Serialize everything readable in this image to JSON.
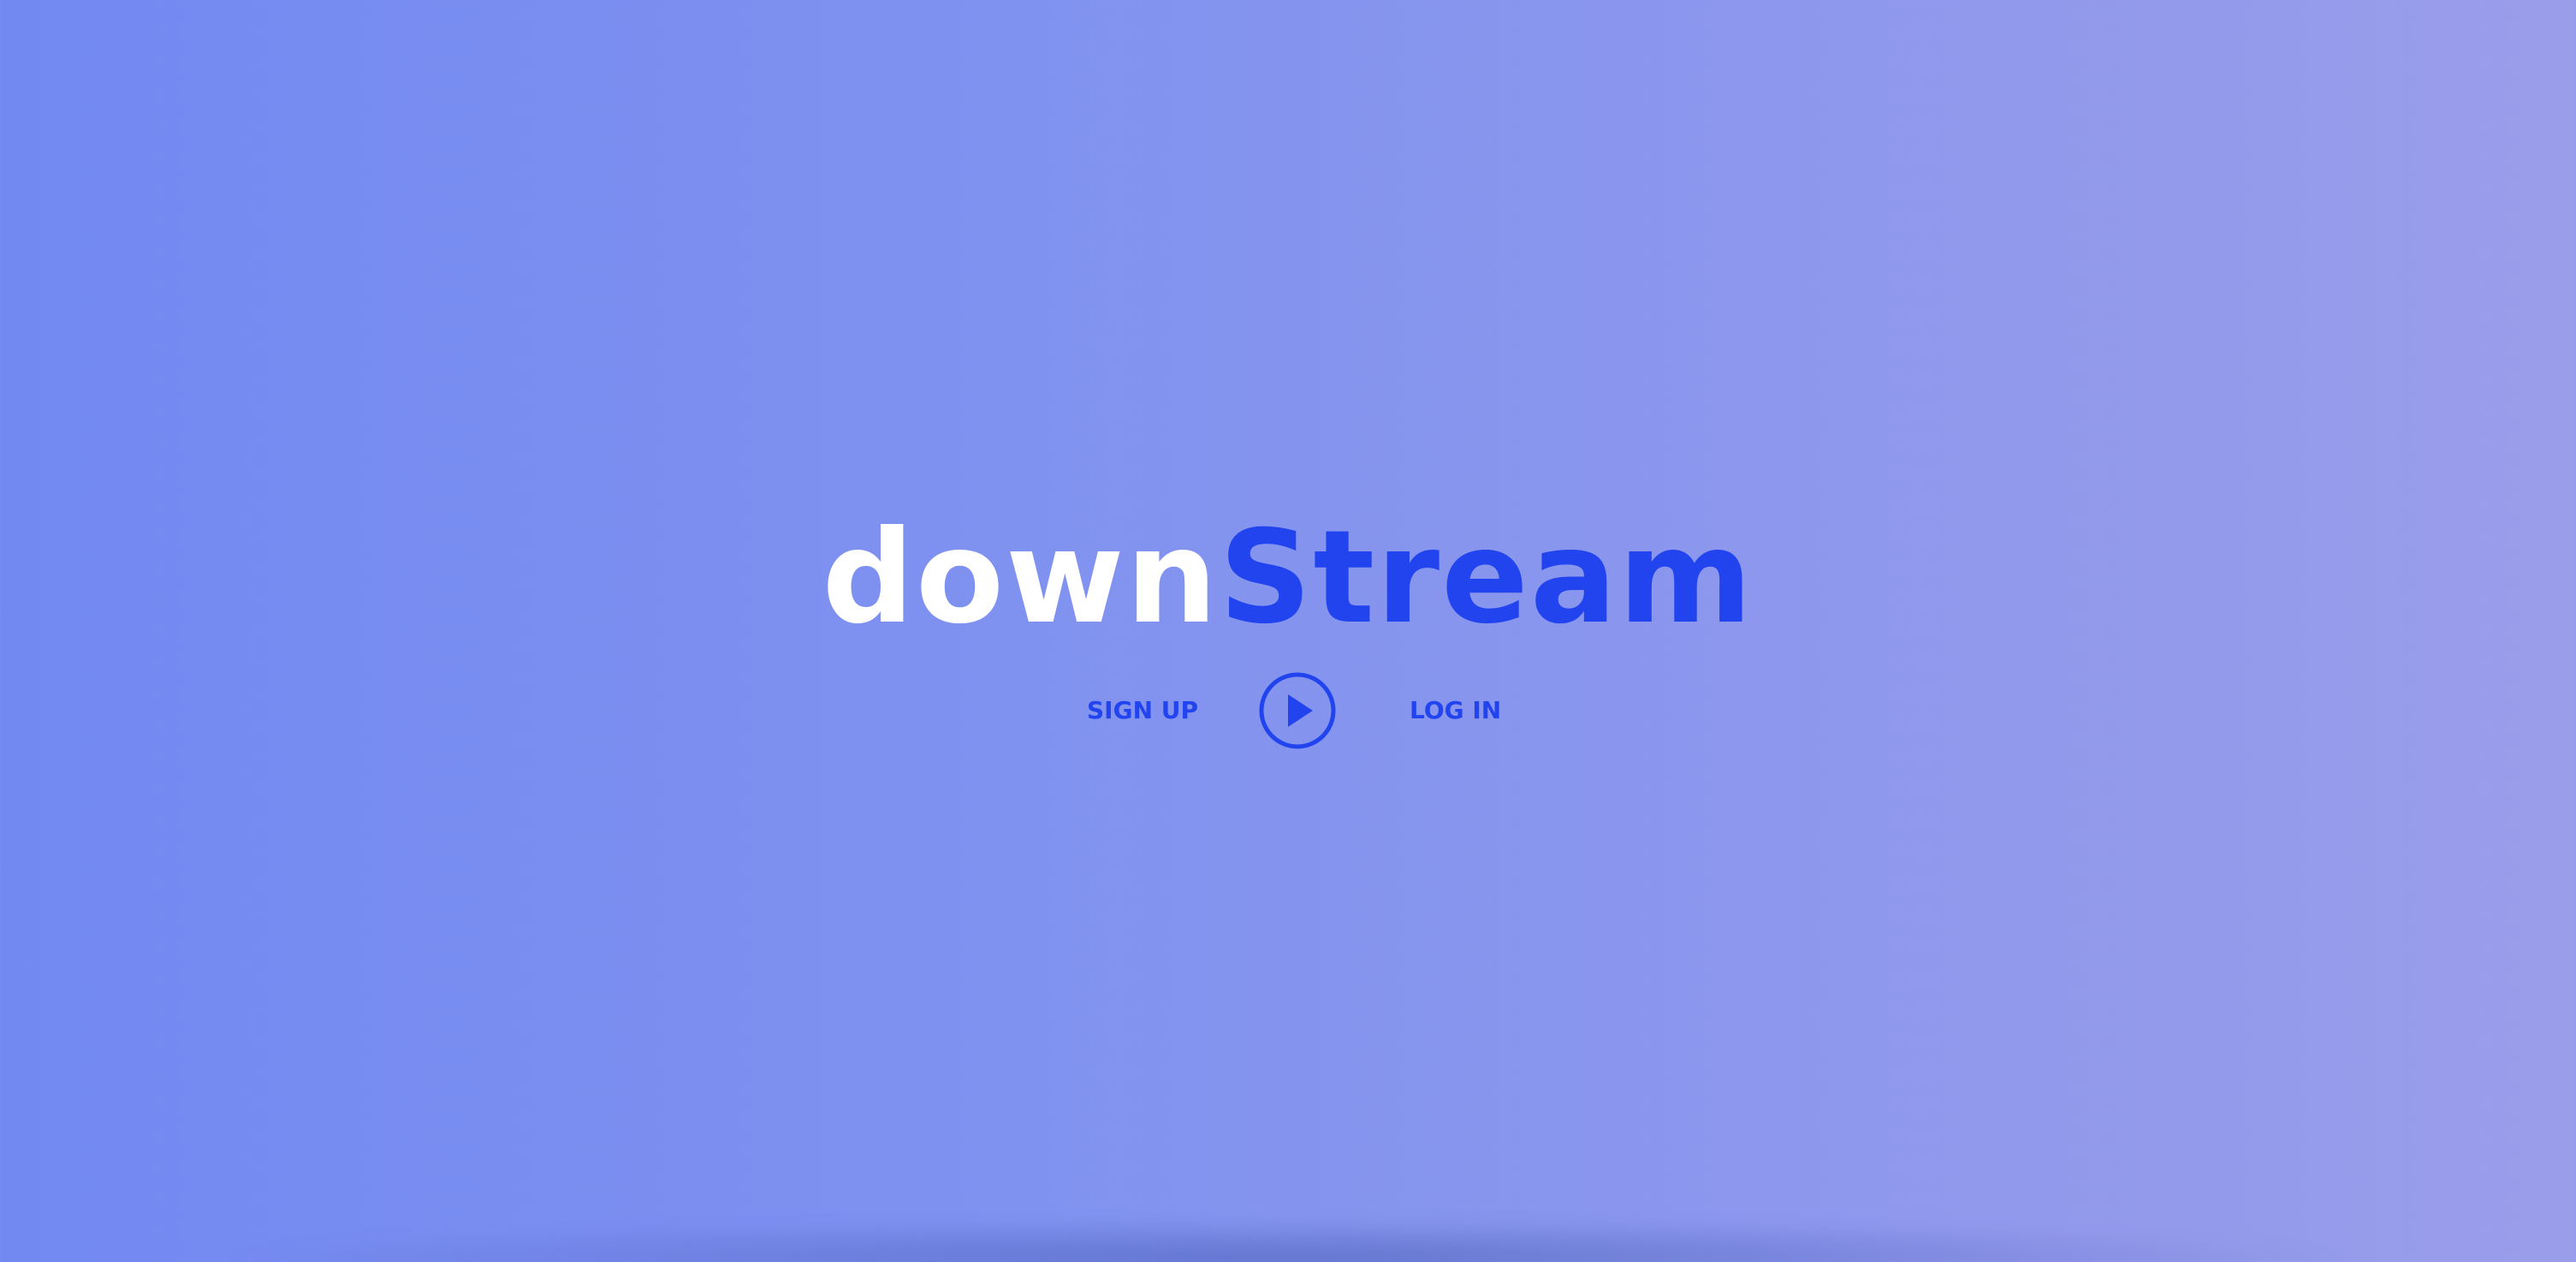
{
  "brand": {
    "part1": "down",
    "part2": "Stream",
    "colors": {
      "part1": "#ffffff",
      "part2": "#2244ee"
    }
  },
  "nav": {
    "signup_label": "SIGN UP",
    "login_label": "LOG IN",
    "play_icon": "play-circle-icon"
  },
  "theme": {
    "background_start": "#7289f2",
    "background_end": "#9a9dea",
    "accent": "#2244ee"
  }
}
